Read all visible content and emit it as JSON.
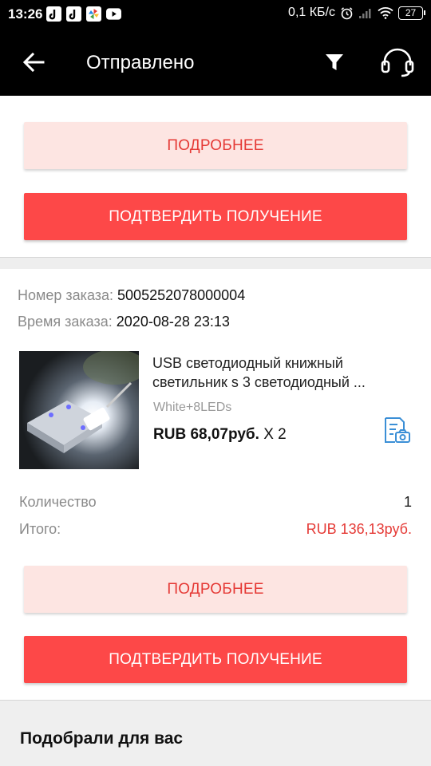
{
  "status_bar": {
    "time": "13:26",
    "speed": "0,1 КБ/с",
    "battery": "27",
    "icons": [
      "tiktok-icon",
      "tiktok-icon",
      "pinwheel-app-icon",
      "youtube-icon",
      "alarm-icon",
      "signal-icon",
      "wifi-icon",
      "battery-icon"
    ]
  },
  "header": {
    "title": "Отправлено",
    "icons": [
      "back-arrow-icon",
      "filter-icon",
      "headset-icon"
    ]
  },
  "order_top": {
    "details_label": "ПОДРОБНЕЕ",
    "confirm_label": "ПОДТВЕРДИТЬ ПОЛУЧЕНИЕ"
  },
  "order": {
    "number_label": "Номер заказа:",
    "number_value": "5005252078000004",
    "time_label": "Время заказа:",
    "time_value": "2020-08-28 23:13",
    "product": {
      "title": "USB светодиодный книжный светильник s 3 светодиодный ...",
      "variant": "White+8LEDs",
      "price": "RUB 68,07руб.",
      "multiplier": "X 2",
      "photo_icon": "photo-receipt-icon"
    },
    "quantity_label": "Количество",
    "quantity_value": "1",
    "total_label": "Итого:",
    "total_value": "RUB 136,13руб.",
    "details_label": "ПОДРОБНЕЕ",
    "confirm_label": "ПОДТВЕРДИТЬ ПОЛУЧЕНИЕ"
  },
  "recommend": {
    "title": "Подобрали для вас"
  },
  "colors": {
    "accent": "#fd4848",
    "accent_light": "#fde5e2",
    "price_red": "#e53935",
    "header_bg": "#000000"
  }
}
